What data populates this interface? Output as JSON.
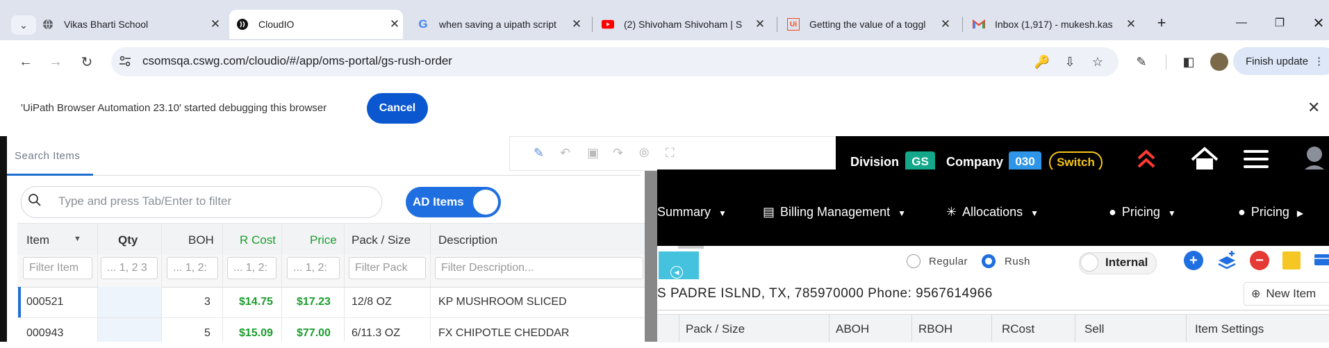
{
  "browser": {
    "tabs": [
      {
        "title": "Vikas Bharti School",
        "icon": "globe-icon"
      },
      {
        "title": "CloudIO",
        "icon": "cloudio-icon"
      },
      {
        "title": "when saving a uipath script",
        "icon": "google-icon"
      },
      {
        "title": "(2) Shivoham Shivoham | S",
        "icon": "youtube-icon"
      },
      {
        "title": "Getting the value of a toggl",
        "icon": "uipath-icon"
      },
      {
        "title": "Inbox (1,917) - mukesh.kas",
        "icon": "gmail-icon"
      }
    ],
    "url": "csomsqa.cswg.com/cloudio/#/app/oms-portal/gs-rush-order",
    "finish_update": "Finish update"
  },
  "debug_bar": {
    "message": "'UiPath Browser Automation 23.10' started debugging this browser",
    "cancel_label": "Cancel"
  },
  "left_panel": {
    "tab_label": "Search Items",
    "search_placeholder": "Type and press Tab/Enter to filter",
    "ad_toggle_label": "AD Items",
    "columns": [
      "Item",
      "Qty",
      "BOH",
      "R Cost",
      "Price",
      "Pack / Size",
      "Description"
    ],
    "filters": [
      "Filter Item",
      "... 1, 2 3",
      "... 1, 2:",
      "... 1, 2:",
      "... 1, 2:",
      "Filter Pack",
      "Filter Description..."
    ],
    "rows": [
      {
        "item": "000521",
        "qty": "",
        "boh": "3",
        "rcost": "$14.75",
        "price": "$17.23",
        "pack": "12/8 OZ",
        "desc": "KP MUSHROOM SLICED"
      },
      {
        "item": "000943",
        "qty": "",
        "boh": "5",
        "rcost": "$15.09",
        "price": "$77.00",
        "pack": "6/11.3 OZ",
        "desc": "FX CHIPOTLE CHEDDAR"
      }
    ]
  },
  "header": {
    "division_label": "Division",
    "division_value": "GS",
    "company_label": "Company",
    "company_value": "030",
    "switch_label": "Switch"
  },
  "nav": [
    "Summary",
    "Billing Management",
    "Allocations",
    "Pricing",
    "Pricing"
  ],
  "order_bar": {
    "regular_label": "Regular",
    "rush_label": "Rush",
    "internal_label": "Internal",
    "address": "S PADRE ISLND, TX, 785970000 Phone: 9567614966",
    "new_item_label": "New Item"
  },
  "right_grid": {
    "columns": [
      "Pack / Size",
      "ABOH",
      "RBOH",
      "RCost",
      "Sell",
      "Item Settings"
    ]
  },
  "colors": {
    "accent": "#1f6fe0",
    "price_green": "#1a9d2c",
    "division_badge": "#13a88a",
    "company_badge": "#2f95e8",
    "switch": "#f5c518"
  }
}
